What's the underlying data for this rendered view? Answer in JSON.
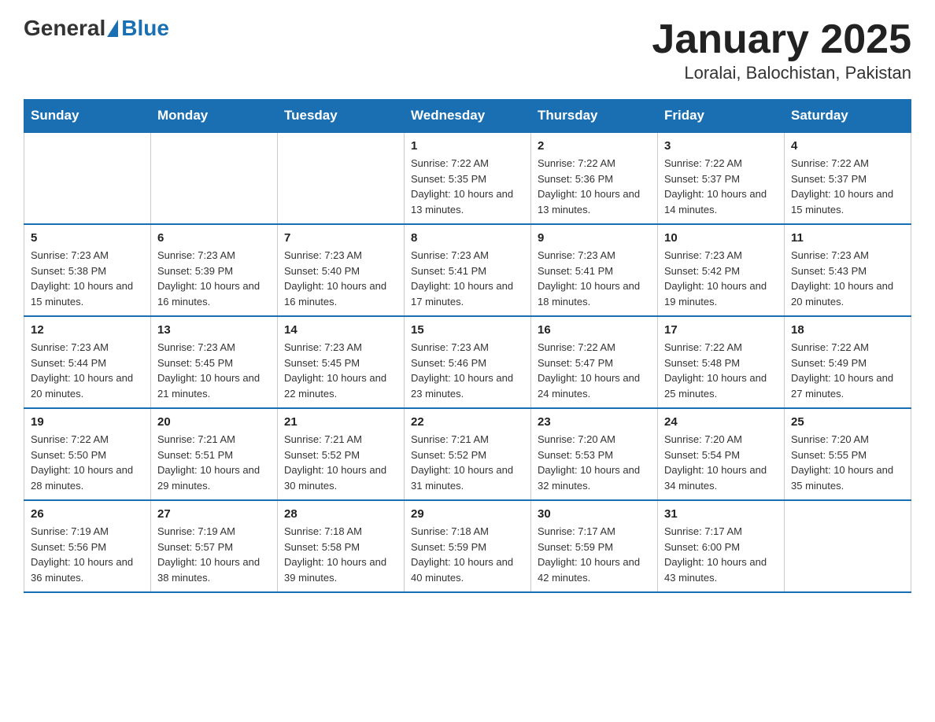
{
  "header": {
    "logo_text_general": "General",
    "logo_text_blue": "Blue",
    "title": "January 2025",
    "subtitle": "Loralai, Balochistan, Pakistan"
  },
  "days_of_week": [
    "Sunday",
    "Monday",
    "Tuesday",
    "Wednesday",
    "Thursday",
    "Friday",
    "Saturday"
  ],
  "weeks": [
    [
      {
        "day": "",
        "info": ""
      },
      {
        "day": "",
        "info": ""
      },
      {
        "day": "",
        "info": ""
      },
      {
        "day": "1",
        "info": "Sunrise: 7:22 AM\nSunset: 5:35 PM\nDaylight: 10 hours\nand 13 minutes."
      },
      {
        "day": "2",
        "info": "Sunrise: 7:22 AM\nSunset: 5:36 PM\nDaylight: 10 hours\nand 13 minutes."
      },
      {
        "day": "3",
        "info": "Sunrise: 7:22 AM\nSunset: 5:37 PM\nDaylight: 10 hours\nand 14 minutes."
      },
      {
        "day": "4",
        "info": "Sunrise: 7:22 AM\nSunset: 5:37 PM\nDaylight: 10 hours\nand 15 minutes."
      }
    ],
    [
      {
        "day": "5",
        "info": "Sunrise: 7:23 AM\nSunset: 5:38 PM\nDaylight: 10 hours\nand 15 minutes."
      },
      {
        "day": "6",
        "info": "Sunrise: 7:23 AM\nSunset: 5:39 PM\nDaylight: 10 hours\nand 16 minutes."
      },
      {
        "day": "7",
        "info": "Sunrise: 7:23 AM\nSunset: 5:40 PM\nDaylight: 10 hours\nand 16 minutes."
      },
      {
        "day": "8",
        "info": "Sunrise: 7:23 AM\nSunset: 5:41 PM\nDaylight: 10 hours\nand 17 minutes."
      },
      {
        "day": "9",
        "info": "Sunrise: 7:23 AM\nSunset: 5:41 PM\nDaylight: 10 hours\nand 18 minutes."
      },
      {
        "day": "10",
        "info": "Sunrise: 7:23 AM\nSunset: 5:42 PM\nDaylight: 10 hours\nand 19 minutes."
      },
      {
        "day": "11",
        "info": "Sunrise: 7:23 AM\nSunset: 5:43 PM\nDaylight: 10 hours\nand 20 minutes."
      }
    ],
    [
      {
        "day": "12",
        "info": "Sunrise: 7:23 AM\nSunset: 5:44 PM\nDaylight: 10 hours\nand 20 minutes."
      },
      {
        "day": "13",
        "info": "Sunrise: 7:23 AM\nSunset: 5:45 PM\nDaylight: 10 hours\nand 21 minutes."
      },
      {
        "day": "14",
        "info": "Sunrise: 7:23 AM\nSunset: 5:45 PM\nDaylight: 10 hours\nand 22 minutes."
      },
      {
        "day": "15",
        "info": "Sunrise: 7:23 AM\nSunset: 5:46 PM\nDaylight: 10 hours\nand 23 minutes."
      },
      {
        "day": "16",
        "info": "Sunrise: 7:22 AM\nSunset: 5:47 PM\nDaylight: 10 hours\nand 24 minutes."
      },
      {
        "day": "17",
        "info": "Sunrise: 7:22 AM\nSunset: 5:48 PM\nDaylight: 10 hours\nand 25 minutes."
      },
      {
        "day": "18",
        "info": "Sunrise: 7:22 AM\nSunset: 5:49 PM\nDaylight: 10 hours\nand 27 minutes."
      }
    ],
    [
      {
        "day": "19",
        "info": "Sunrise: 7:22 AM\nSunset: 5:50 PM\nDaylight: 10 hours\nand 28 minutes."
      },
      {
        "day": "20",
        "info": "Sunrise: 7:21 AM\nSunset: 5:51 PM\nDaylight: 10 hours\nand 29 minutes."
      },
      {
        "day": "21",
        "info": "Sunrise: 7:21 AM\nSunset: 5:52 PM\nDaylight: 10 hours\nand 30 minutes."
      },
      {
        "day": "22",
        "info": "Sunrise: 7:21 AM\nSunset: 5:52 PM\nDaylight: 10 hours\nand 31 minutes."
      },
      {
        "day": "23",
        "info": "Sunrise: 7:20 AM\nSunset: 5:53 PM\nDaylight: 10 hours\nand 32 minutes."
      },
      {
        "day": "24",
        "info": "Sunrise: 7:20 AM\nSunset: 5:54 PM\nDaylight: 10 hours\nand 34 minutes."
      },
      {
        "day": "25",
        "info": "Sunrise: 7:20 AM\nSunset: 5:55 PM\nDaylight: 10 hours\nand 35 minutes."
      }
    ],
    [
      {
        "day": "26",
        "info": "Sunrise: 7:19 AM\nSunset: 5:56 PM\nDaylight: 10 hours\nand 36 minutes."
      },
      {
        "day": "27",
        "info": "Sunrise: 7:19 AM\nSunset: 5:57 PM\nDaylight: 10 hours\nand 38 minutes."
      },
      {
        "day": "28",
        "info": "Sunrise: 7:18 AM\nSunset: 5:58 PM\nDaylight: 10 hours\nand 39 minutes."
      },
      {
        "day": "29",
        "info": "Sunrise: 7:18 AM\nSunset: 5:59 PM\nDaylight: 10 hours\nand 40 minutes."
      },
      {
        "day": "30",
        "info": "Sunrise: 7:17 AM\nSunset: 5:59 PM\nDaylight: 10 hours\nand 42 minutes."
      },
      {
        "day": "31",
        "info": "Sunrise: 7:17 AM\nSunset: 6:00 PM\nDaylight: 10 hours\nand 43 minutes."
      },
      {
        "day": "",
        "info": ""
      }
    ]
  ]
}
